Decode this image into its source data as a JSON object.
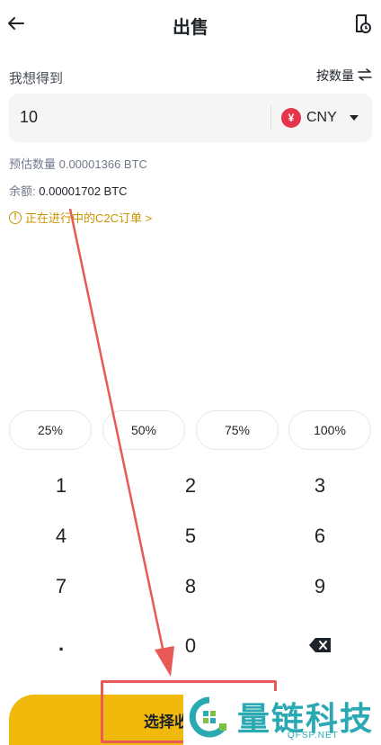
{
  "header": {
    "title": "出售",
    "back_icon": "arrow-left-icon",
    "history_icon": "order-history-icon"
  },
  "form": {
    "want_label": "我想得到",
    "by_quantity_label": "按数量",
    "amount_value": "10",
    "currency_symbol": "¥",
    "currency": "CNY"
  },
  "info": {
    "estimate": "预估数量 0.00001366 BTC",
    "balance_label": "余额:",
    "balance_value": "0.00001702 BTC",
    "orders_notice": "正在进行中的C2C订单 >"
  },
  "percent_buttons": [
    "25%",
    "50%",
    "75%",
    "100%"
  ],
  "keypad": {
    "k1": "1",
    "k2": "2",
    "k3": "3",
    "k4": "4",
    "k5": "5",
    "k6": "6",
    "k7": "7",
    "k8": "8",
    "k9": "9",
    "kdot": ".",
    "k0": "0",
    "kdel": "backspace-icon"
  },
  "bottom": {
    "label": "选择收"
  },
  "watermark": {
    "text": "量链科技",
    "url": "QFSP.NET"
  },
  "colors": {
    "accent": "#f0b90b",
    "annotation": "#e85a55",
    "notice": "#c99400"
  }
}
